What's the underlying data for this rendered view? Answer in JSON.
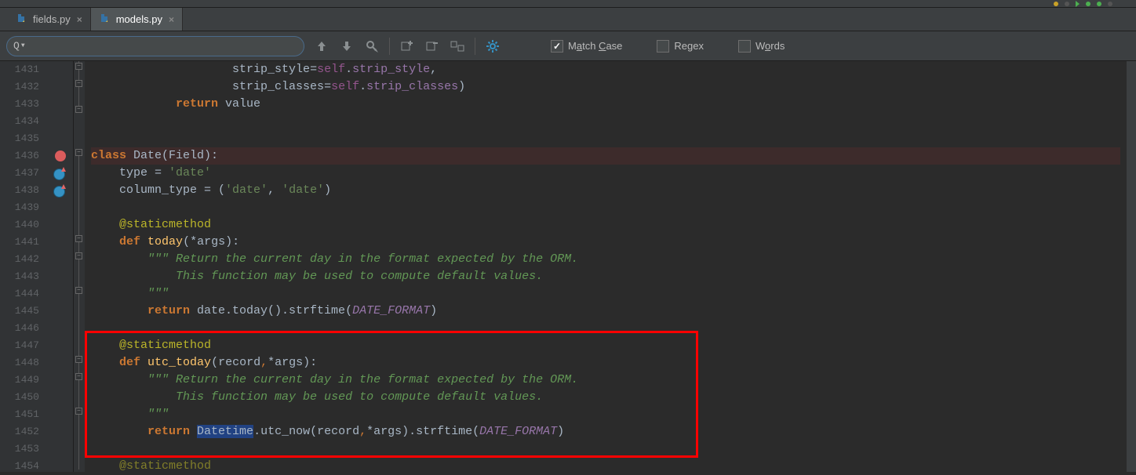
{
  "tabs": [
    {
      "name": "fields.py",
      "active": false
    },
    {
      "name": "models.py",
      "active": true
    }
  ],
  "search": {
    "value": ""
  },
  "options": {
    "match_case": {
      "label_pre": "M",
      "label_u": "a",
      "label_post": "tch ",
      "label_u2": "C",
      "label_post2": "ase",
      "checked": true
    },
    "regex": {
      "label_pre": "Re",
      "label_u": "g",
      "label_post": "ex",
      "checked": false
    },
    "words": {
      "label_pre": "W",
      "label_u": "o",
      "label_post": "rds",
      "checked": false
    }
  },
  "line_numbers": [
    "1431",
    "1432",
    "1433",
    "1434",
    "1435",
    "1436",
    "1437",
    "1438",
    "1439",
    "1440",
    "1441",
    "1442",
    "1443",
    "1444",
    "1445",
    "1446",
    "1447",
    "1448",
    "1449",
    "1450",
    "1451",
    "1452",
    "1453",
    "1454"
  ],
  "code": {
    "l1431": {
      "indent": "                    ",
      "p1": "strip_style",
      "p2": "=",
      "p3": "self",
      "p4": ".",
      "p5": "strip_style",
      "p6": ","
    },
    "l1432": {
      "indent": "                    ",
      "p1": "strip_classes",
      "p2": "=",
      "p3": "self",
      "p4": ".",
      "p5": "strip_classes",
      "p6": ")"
    },
    "l1433": {
      "indent": "            ",
      "p1": "return",
      "p2": " value"
    },
    "l1436": {
      "indent": "",
      "p1": "class",
      "p2": " ",
      "p3": "Date",
      "p4": "(Field):"
    },
    "l1437": {
      "indent": "    ",
      "p1": "type = ",
      "p2": "'date'"
    },
    "l1438": {
      "indent": "    ",
      "p1": "column_type = (",
      "p2": "'date'",
      "p3": ", ",
      "p4": "'date'",
      "p5": ")"
    },
    "l1440": {
      "indent": "    ",
      "p1": "@staticmethod"
    },
    "l1441": {
      "indent": "    ",
      "p1": "def",
      "p2": " ",
      "p3": "today",
      "p4": "(*args):"
    },
    "l1442": {
      "indent": "        ",
      "p1": "\"\"\" Return the current day in the format expected by the ORM."
    },
    "l1443": {
      "indent": "            ",
      "p1": "This function may be used to compute default values."
    },
    "l1444": {
      "indent": "        ",
      "p1": "\"\"\""
    },
    "l1445": {
      "indent": "        ",
      "p1": "return",
      "p2": " date.today().strftime(",
      "p3": "DATE_FORMAT",
      "p4": ")"
    },
    "l1447": {
      "indent": "    ",
      "p1": "@staticmethod"
    },
    "l1448": {
      "indent": "    ",
      "p1": "def",
      "p2": " ",
      "p3": "utc_today",
      "p4": "(record",
      "p5": ",",
      "p6": "*args):"
    },
    "l1449": {
      "indent": "        ",
      "p1": "\"\"\" Return the current day in the format expected by the ORM."
    },
    "l1450": {
      "indent": "            ",
      "p1": "This function may be used to compute default values."
    },
    "l1451": {
      "indent": "        ",
      "p1": "\"\"\""
    },
    "l1452": {
      "indent": "        ",
      "p1": "return",
      "p2": " ",
      "p3": "Datetime",
      "p4": ".utc_now(record",
      "p5": ",",
      "p6": "*args).strftime(",
      "p7": "DATE_FORMAT",
      "p8": ")"
    },
    "l1454": {
      "indent": "    ",
      "p1": "@staticmethod"
    }
  }
}
